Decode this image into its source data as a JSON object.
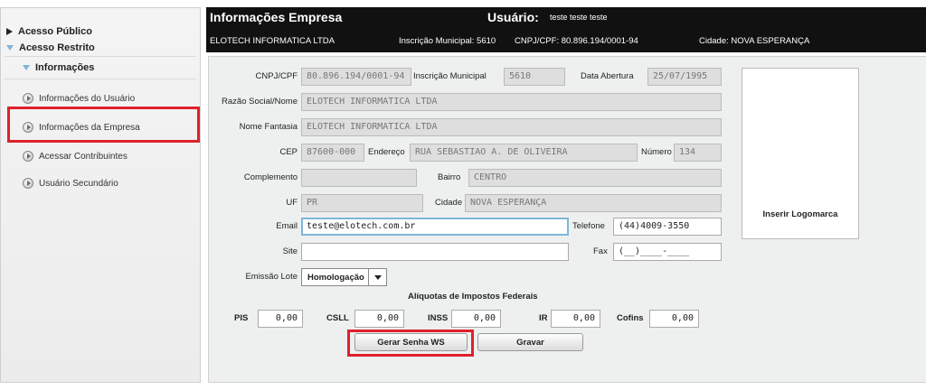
{
  "sidebar": {
    "public_label": "Acesso Público",
    "restricted_label": "Acesso Restrito",
    "group_label": "Informações",
    "items": [
      {
        "label": "Informações do Usuário"
      },
      {
        "label": "Informações da Empresa"
      },
      {
        "label": "Acessar Contribuintes"
      },
      {
        "label": "Usuário Secundário"
      }
    ]
  },
  "header": {
    "title": "Informações Empresa",
    "user_label": "Usuário:",
    "user_value": "teste teste teste",
    "company": "ELOTECH INFORMATICA LTDA",
    "inscricao": "Inscrição Municipal:  5610",
    "cnpj": "CNPJ/CPF:  80.896.194/0001-94",
    "cidade": "Cidade:  NOVA ESPERANÇA"
  },
  "form": {
    "cnpj_label": "CNPJ/CPF",
    "cnpj": "80.896.194/0001-94",
    "inscricao_label": "Inscrição Municipal",
    "inscricao": "5610",
    "abertura_label": "Data Abertura",
    "abertura": "25/07/1995",
    "razao_label": "Razão Social/Nome",
    "razao": "ELOTECH INFORMATICA LTDA",
    "fantasia_label": "Nome Fantasia",
    "fantasia": "ELOTECH INFORMATICA LTDA",
    "cep_label": "CEP",
    "cep": "87600-000",
    "endereco_label": "Endereço",
    "endereco": "RUA SEBASTIAO A. DE OLIVEIRA",
    "numero_label": "Número",
    "numero": "134",
    "complemento_label": "Complemento",
    "complemento": "",
    "bairro_label": "Bairro",
    "bairro": "CENTRO",
    "uf_label": "UF",
    "uf": "PR",
    "cidade_label": "Cidade",
    "cidade": "NOVA ESPERANÇA",
    "email_label": "Email",
    "email": "teste@elotech.com.br",
    "telefone_label": "Telefone",
    "telefone": "(44)4009-3550",
    "site_label": "Site",
    "site": "",
    "fax_label": "Fax",
    "fax": "(__)____-____",
    "emissao_label": "Emissão Lote",
    "emissao": "Homologação",
    "logo_label": "Inserir Logomarca"
  },
  "impostos": {
    "title": "Alíquotas de Impostos Federais",
    "pis_label": "PIS",
    "pis": "0,00",
    "csll_label": "CSLL",
    "csll": "0,00",
    "inss_label": "INSS",
    "inss": "0,00",
    "ir_label": "IR",
    "ir": "0,00",
    "cofins_label": "Cofins",
    "cofins": "0,00"
  },
  "buttons": {
    "gerar_senha": "Gerar Senha WS",
    "gravar": "Gravar"
  },
  "colors": {
    "highlight": "#e0202c",
    "header_bg": "#111111",
    "active_border": "#7fb6d6"
  }
}
